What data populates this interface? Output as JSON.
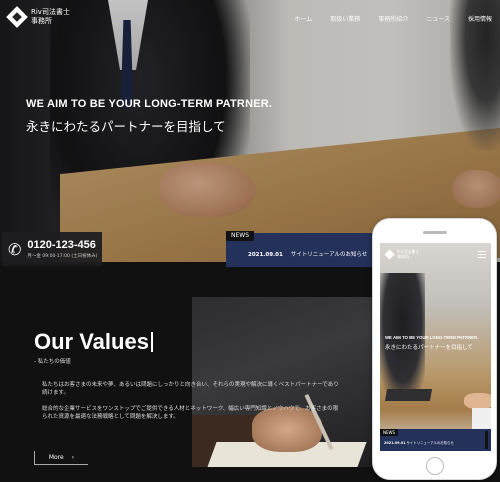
{
  "site": {
    "logo_text": "Riv司法書士\n事務所",
    "nav": [
      "ホーム",
      "取扱い業務",
      "事務所紹介",
      "ニュース",
      "採用情報"
    ]
  },
  "hero": {
    "tagline_en": "WE AIM TO BE YOUR LONG-TERM PATRNER.",
    "tagline_jp": "永きにわたるパートナーを目指して"
  },
  "contact": {
    "phone": "0120-123-456",
    "hours": "月〜金 09:00-17:00 (土日祝休み)"
  },
  "news": {
    "label": "NEWS",
    "date": "2021.09.01",
    "title": "サイトリニューアルのお知らせ"
  },
  "values": {
    "title": "Our Values",
    "subtitle": "- 私たちの価値",
    "paragraph1": "私たちはお客さまの未来や夢、あるいは問題にしっかりと向き合い、それらの実現や解決に導くベストパートナーであり続けます。",
    "paragraph2": "総合的な企業サービスをワンストップでご提供できる人材とネットワーク、幅広い専門知識とノウハウで、お客さまの限られた資源を最適な法務戦略として問題を解決します。",
    "more_label": "More"
  },
  "mobile": {
    "logo_text": "Riv司法書士\n事務所",
    "tagline_en": "WE AIM TO BE YOUR LONG-TERM PATRNER.",
    "tagline_jp": "永きにわたるパートナーを目指して",
    "news_label": "NEWS",
    "news_date": "2021.09.01",
    "news_title": "サイトリニューアルのお知らせ"
  },
  "colors": {
    "news_bg": "#24315a",
    "page_bg": "#111111"
  }
}
